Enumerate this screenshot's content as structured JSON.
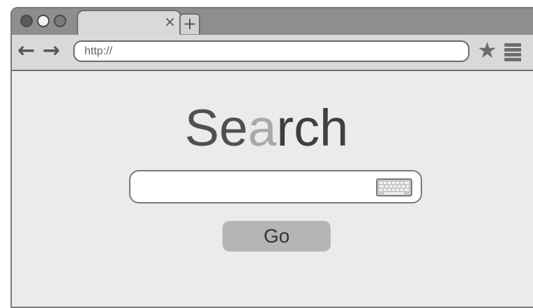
{
  "tabbar": {
    "tab_close_glyph": "×",
    "new_tab_glyph": "+"
  },
  "toolbar": {
    "back_glyph": "←",
    "forward_glyph": "→",
    "url_value": "http://",
    "star_glyph": "★"
  },
  "main": {
    "title_part1": "Se",
    "title_part2": "a",
    "title_part3": "rch",
    "search_value": "",
    "go_label": "Go"
  },
  "colors": {
    "tabbar_bg": "#8e8e8e",
    "toolbar_bg": "#d9d9d9",
    "content_bg": "#ebebeb",
    "button_bg": "#b5b5b5"
  },
  "icons": [
    "close-icon",
    "new-tab-icon",
    "back-arrow-icon",
    "forward-arrow-icon",
    "star-icon",
    "menu-icon",
    "keyboard-icon"
  ]
}
